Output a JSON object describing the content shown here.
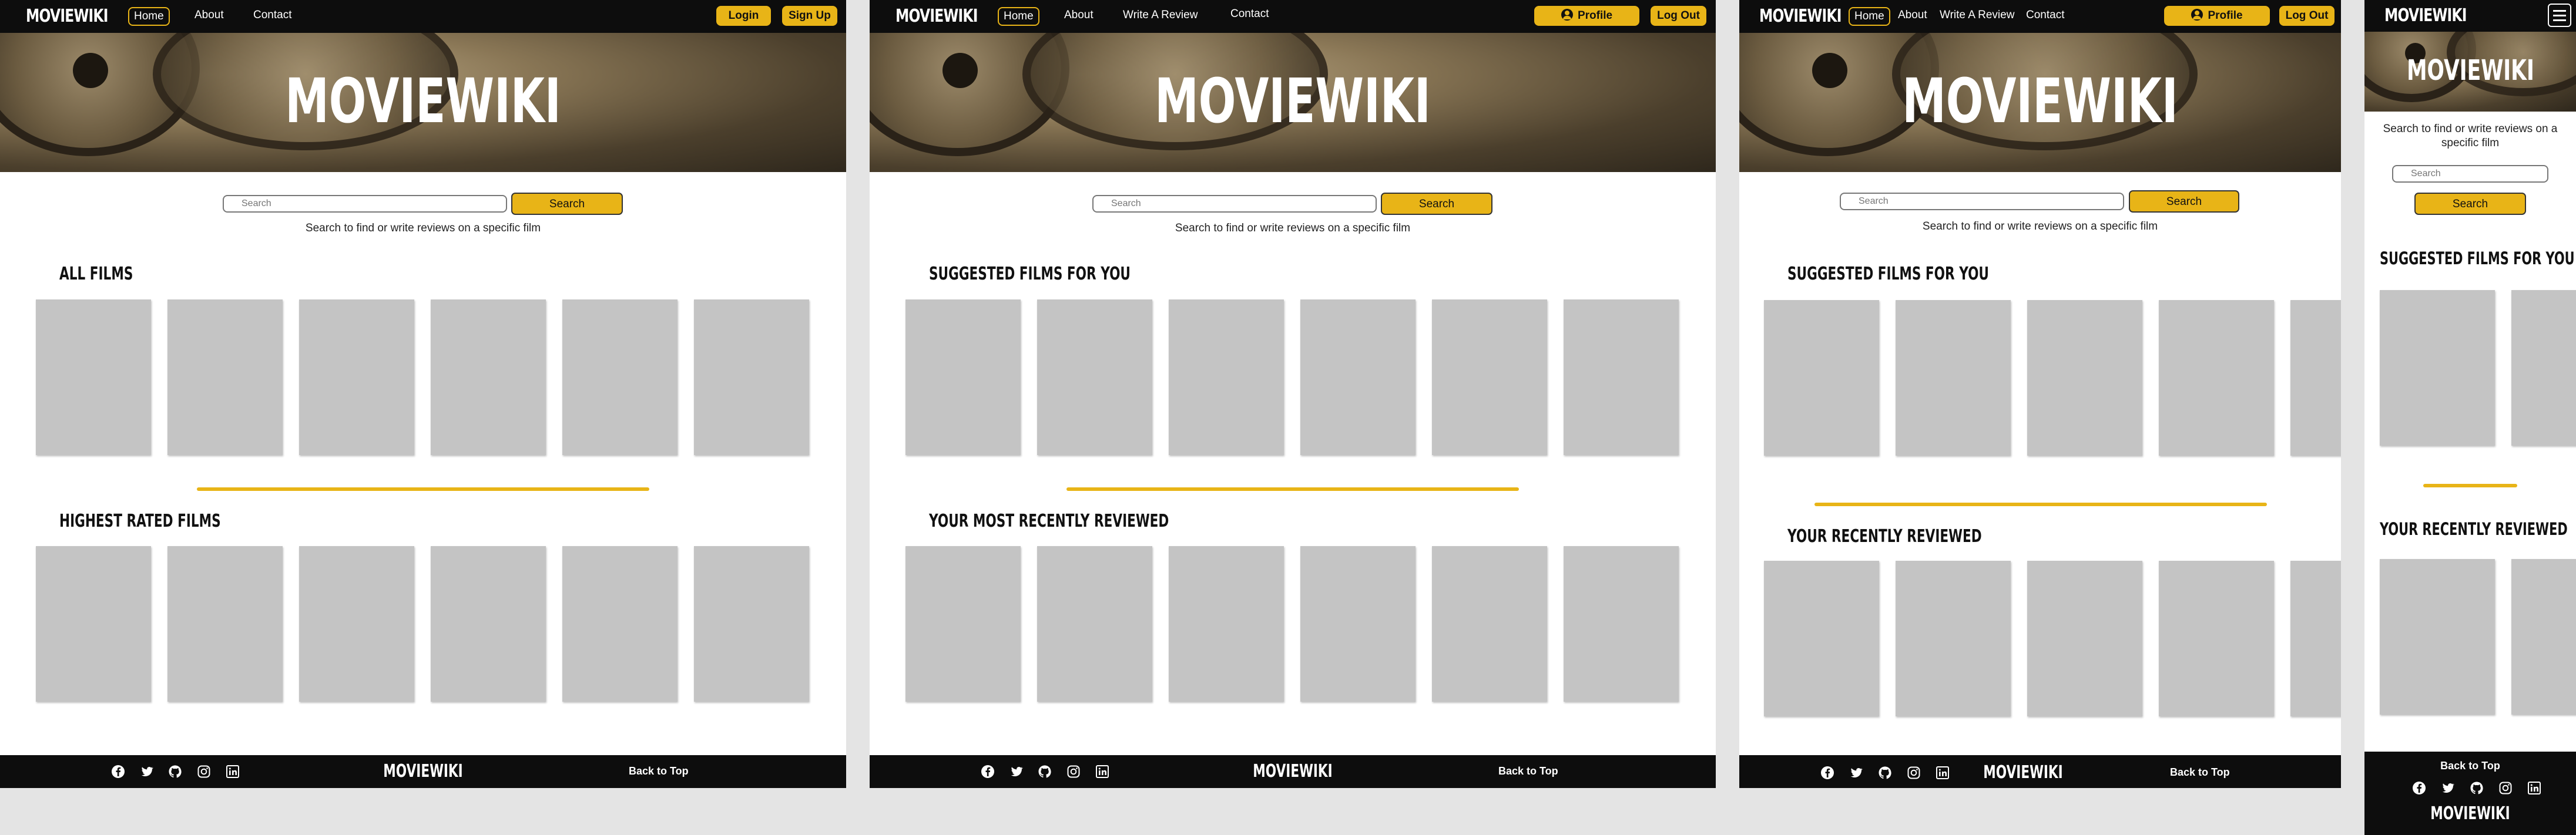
{
  "brand": "MOVIEWIKI",
  "hero_title": "MOVIEWIKI",
  "nav_guest": {
    "home": "Home",
    "about": "About",
    "contact": "Contact",
    "login": "Login",
    "signup": "Sign Up"
  },
  "nav_user": {
    "home": "Home",
    "about": "About",
    "write_review": "Write A Review",
    "contact": "Contact",
    "profile": "Profile",
    "logout": "Log Out"
  },
  "search": {
    "placeholder": "Search",
    "button": "Search",
    "help": "Search to find or write reviews on a specific film"
  },
  "sections": {
    "all_films": "ALL FILMS",
    "highest_rated": "HIGHEST RATED FILMS",
    "suggested": "SUGGESTED FILMS FOR YOU",
    "most_recently_reviewed": "YOUR MOST RECENTLY REVIEWED",
    "recently_reviewed": "YOUR RECENTLY REVIEWED"
  },
  "footer": {
    "brand": "MOVIEWIKI",
    "back_to_top": "Back to Top",
    "social_icons": [
      "facebook-icon",
      "twitter-icon",
      "github-icon",
      "instagram-icon",
      "linkedin-icon"
    ]
  },
  "colors": {
    "accent": "#e8b417",
    "nav_bg": "#0d0d0d",
    "card": "#c4c4c4",
    "canvas": "#e4e4e4"
  }
}
